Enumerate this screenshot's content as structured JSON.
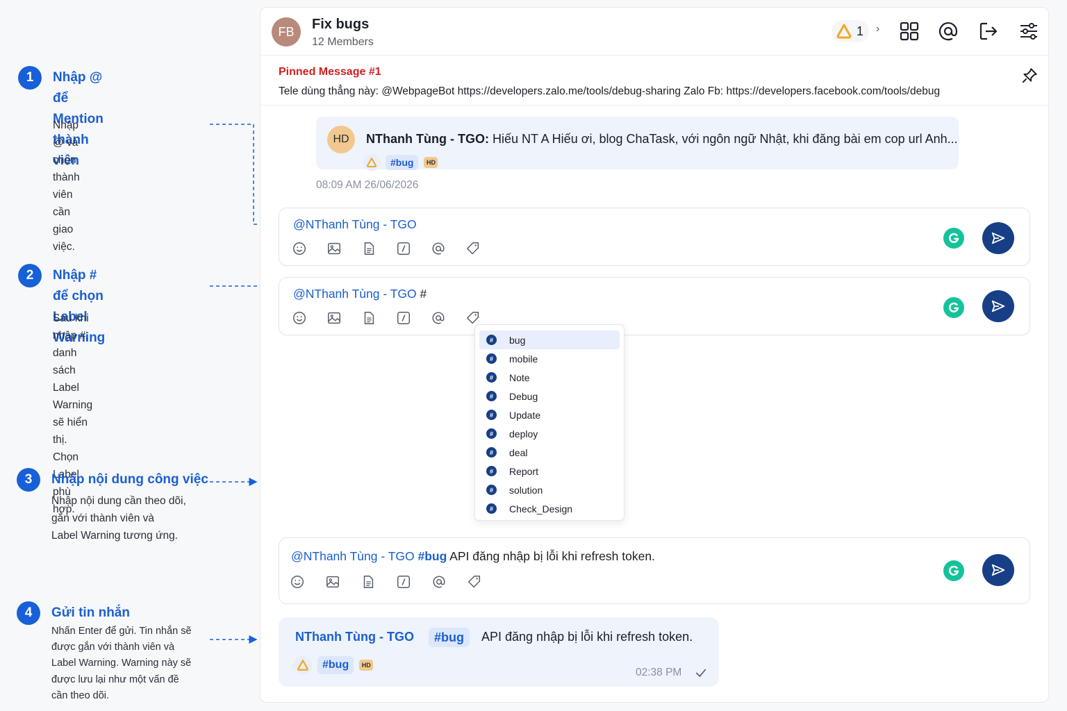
{
  "guide": {
    "steps": [
      {
        "num": "1",
        "title_lines": [
          "Nhập @ để Mention",
          "thành viên"
        ],
        "desc_lines": [
          "Nhập @ và chọn thành viên",
          "cần giao việc."
        ]
      },
      {
        "num": "2",
        "title_lines": [
          "Nhập # để chọn",
          "Label Warning"
        ],
        "desc_lines": [
          "Sau khi nhập #, danh sách",
          "Label Warning sẽ hiển thị.",
          "Chọn Label phù hợp."
        ]
      },
      {
        "num": "3",
        "title_lines": [
          "Nhập nội dung công việc"
        ],
        "desc_lines": [
          "Nhập nội dung cần theo dõi,",
          "gắn với thành viên và",
          "Label Warning tương ứng."
        ]
      },
      {
        "num": "4",
        "title_lines": [
          "Gửi tin nhắn"
        ],
        "desc_lines": [
          "Nhấn Enter để gửi. Tin nhắn sẽ",
          "được gắn với thành viên và",
          "Label Warning. Warning này sẽ",
          "được lưu lại như một vấn đề",
          "cần theo dõi."
        ]
      }
    ]
  },
  "header": {
    "avatar_initials": "FB",
    "title": "Fix bugs",
    "subtitle": "12 Members",
    "warning_count": "1"
  },
  "pinned": {
    "title": "Pinned Message #1",
    "text": "Tele dùng thẳng này: @WebpageBot https://developers.zalo.me/tools/debug-sharing Zalo Fb: https://developers.facebook.com/tools/debug"
  },
  "quoted": {
    "avatar_initials": "HD",
    "sender": "NThanh Tùng - TGO:",
    "text": " Hiếu NT A Hiếu ơi, blog ChaTask, với ngôn ngữ Nhật, khi đăng bài em cop url Anh...",
    "tag": "#bug",
    "hd_badge": "HD",
    "timestamp": "08:09 AM 26/06/2026"
  },
  "composer1": {
    "mention": "@NThanh Tùng - TGO"
  },
  "composer2": {
    "mention": "@NThanh Tùng - TGO",
    "typed": " #"
  },
  "label_dropdown": {
    "items": [
      "bug",
      "mobile",
      "Note",
      "Debug",
      "Update",
      "deploy",
      "deal",
      "Report",
      "solution",
      "Check_Design"
    ],
    "selected": "bug"
  },
  "composer3": {
    "mention": "@NThanh Tùng - TGO",
    "tag": " #bug",
    "text": " API đăng nhập bị lỗi khi refresh token."
  },
  "sent_message": {
    "sender": "NThanh Tùng - TGO",
    "tag": "#bug",
    "text": "API đăng nhập bị lỗi khi refresh token.",
    "chip_tag": "#bug",
    "hd_badge": "HD",
    "time": "02:38 PM"
  },
  "colors": {
    "accent": "#1a5fd0",
    "send": "#173f86",
    "pinned_title": "#d11f1f",
    "grammarly": "#15c39a",
    "warning": "#f5a623"
  },
  "icons": [
    "fire-warning-icon",
    "grid-icon",
    "at-icon",
    "logout-icon",
    "settings-sliders-icon",
    "pin-icon",
    "emoji-icon",
    "image-icon",
    "file-icon",
    "slash-command-icon",
    "mention-icon",
    "tag-icon",
    "grammarly-icon",
    "send-icon",
    "hashtag-icon",
    "check-icon"
  ]
}
